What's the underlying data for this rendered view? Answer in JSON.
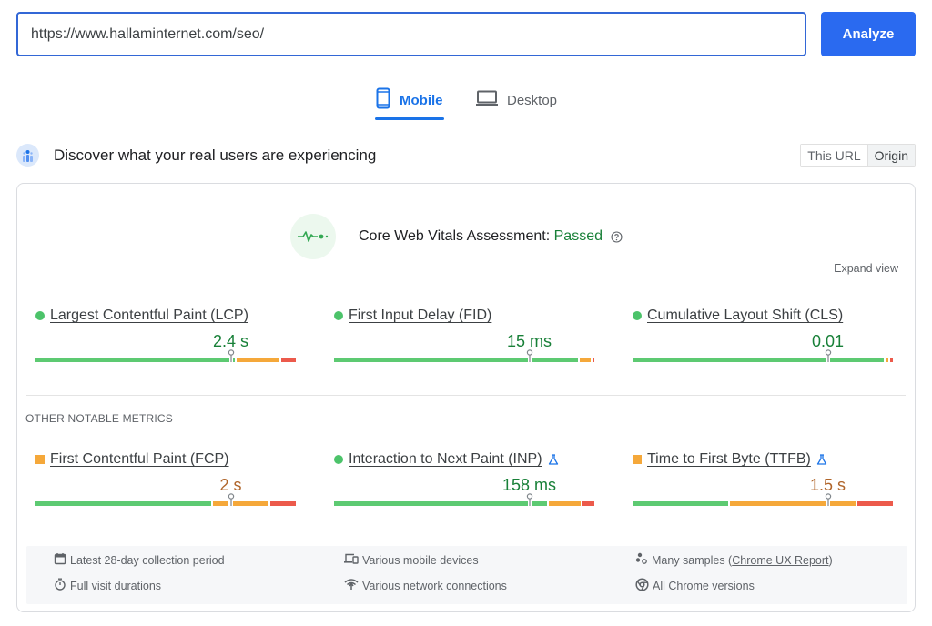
{
  "search": {
    "url_value": "https://www.hallaminternet.com/seo/",
    "analyze_label": "Analyze"
  },
  "device_tabs": [
    {
      "label": "Mobile",
      "icon": "smartphone-icon",
      "active": true
    },
    {
      "label": "Desktop",
      "icon": "laptop-icon",
      "active": false
    }
  ],
  "section": {
    "title": "Discover what your real users are experiencing",
    "icon": "crux-users-icon",
    "scope_toggle": [
      {
        "label": "This URL",
        "active": false
      },
      {
        "label": "Origin",
        "active": true
      }
    ]
  },
  "assessment": {
    "label": "Core Web Vitals Assessment:",
    "status": "Passed",
    "status_color": "#188038",
    "expand_label": "Expand view"
  },
  "core_metrics": [
    {
      "name": "Largest Contentful Paint (LCP)",
      "value": "2.4 s",
      "rating": "good",
      "marker_fraction": 0.75,
      "distribution": {
        "good": 0.77,
        "needs_improvement": 0.17,
        "poor": 0.06
      }
    },
    {
      "name": "First Input Delay (FID)",
      "value": "15 ms",
      "rating": "good",
      "marker_fraction": 0.75,
      "distribution": {
        "good": 0.94,
        "needs_improvement": 0.05,
        "poor": 0.01
      }
    },
    {
      "name": "Cumulative Layout Shift (CLS)",
      "value": "0.01",
      "rating": "good",
      "marker_fraction": 0.75,
      "distribution": {
        "good": 0.97,
        "needs_improvement": 0.015,
        "poor": 0.015
      }
    }
  ],
  "other_metrics_title": "OTHER NOTABLE METRICS",
  "other_metrics": [
    {
      "name": "First Contentful Paint (FCP)",
      "value": "2 s",
      "rating": "average",
      "experimental": false,
      "marker_fraction": 0.75,
      "distribution": {
        "good": 0.68,
        "needs_improvement": 0.22,
        "poor": 0.1
      }
    },
    {
      "name": "Interaction to Next Paint (INP)",
      "value": "158 ms",
      "rating": "good",
      "experimental": true,
      "marker_fraction": 0.75,
      "distribution": {
        "good": 0.82,
        "needs_improvement": 0.13,
        "poor": 0.05
      }
    },
    {
      "name": "Time to First Byte (TTFB)",
      "value": "1.5 s",
      "rating": "average",
      "experimental": true,
      "marker_fraction": 0.75,
      "distribution": {
        "good": 0.37,
        "needs_improvement": 0.49,
        "poor": 0.14
      }
    }
  ],
  "colors": {
    "good": "#5dca72",
    "needs_improvement": "#f5a83a",
    "poor": "#ec5a4b",
    "accent": "#1a73e8",
    "button": "#2a6af0"
  },
  "info": {
    "collection_period": "Latest 28-day collection period",
    "visit_durations": "Full visit durations",
    "devices": "Various mobile devices",
    "network": "Various network connections",
    "samples_prefix": "Many samples (",
    "samples_link": "Chrome UX Report",
    "samples_suffix": ")",
    "chrome_versions": "All Chrome versions"
  }
}
